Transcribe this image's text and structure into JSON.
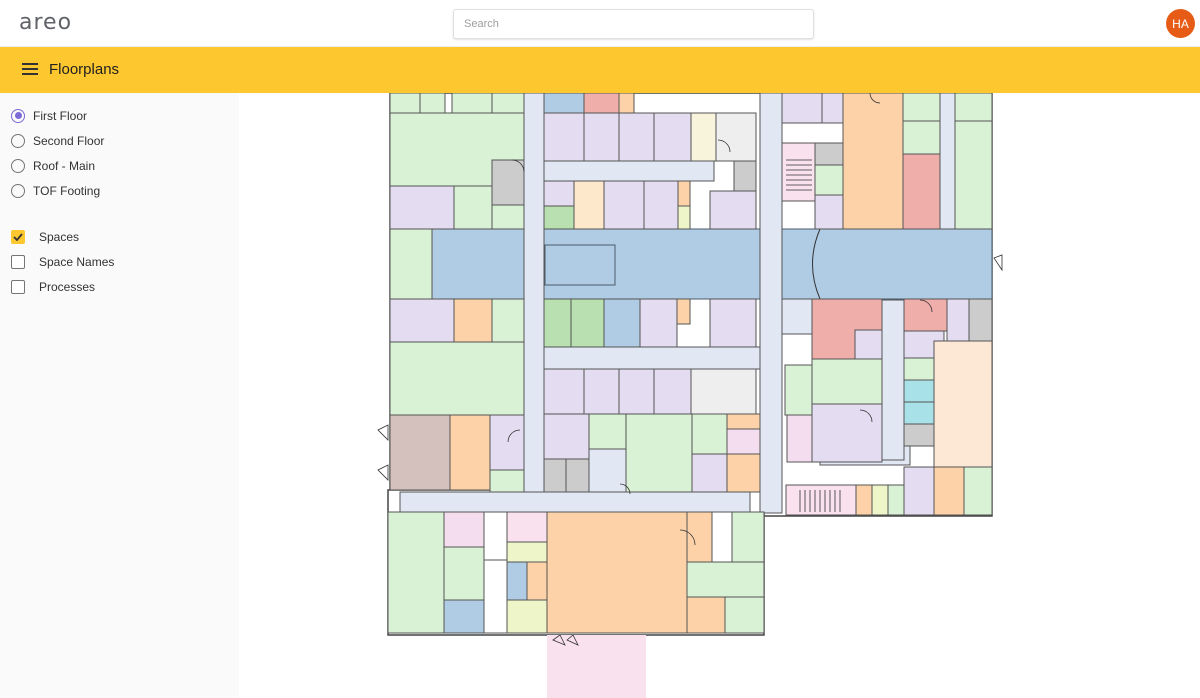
{
  "app": {
    "logo": "areo"
  },
  "search": {
    "placeholder": "Search",
    "value": ""
  },
  "user": {
    "initials": "HA"
  },
  "appbar": {
    "title": "Floorplans"
  },
  "floors": {
    "selected_index": 0,
    "items": [
      {
        "label": "First Floor",
        "selected": true
      },
      {
        "label": "Second Floor",
        "selected": false
      },
      {
        "label": "Roof - Main",
        "selected": false
      },
      {
        "label": "TOF Footing",
        "selected": false
      }
    ]
  },
  "layers": {
    "items": [
      {
        "label": "Spaces",
        "checked": true
      },
      {
        "label": "Space Names",
        "checked": false
      },
      {
        "label": "Processes",
        "checked": false
      }
    ]
  },
  "colors": {
    "accent": "#fdc82f",
    "avatar": "#e65c17",
    "radio_selected": "#7c6ad6",
    "corridor": "#b0cce4",
    "hall": "#e1e8f4",
    "green": "#d9f1d4",
    "purple": "#e4dcf0",
    "orange": "#fdd2a8",
    "red": "#f0aeab",
    "pink": "#f5ddf0"
  }
}
